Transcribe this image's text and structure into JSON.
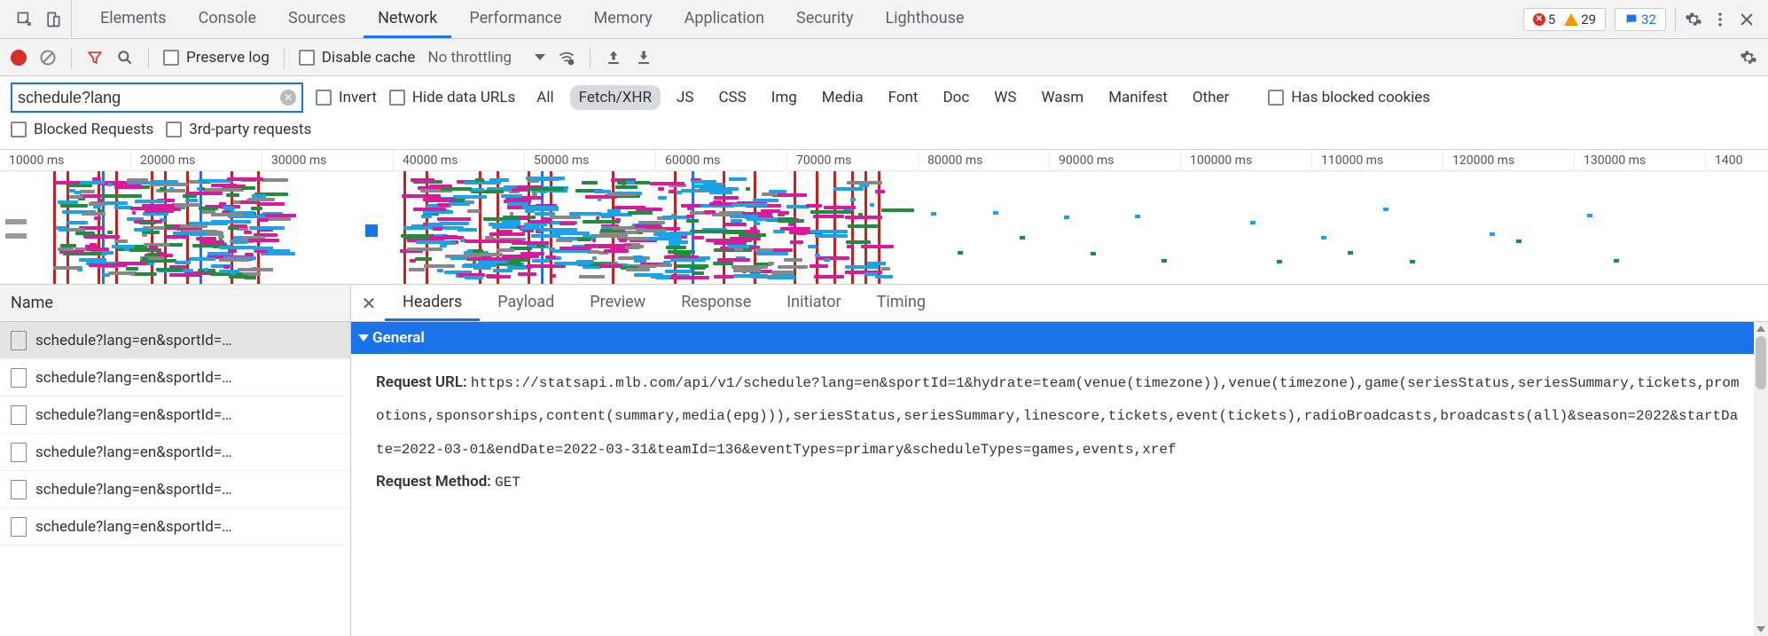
{
  "mainTabs": [
    "Elements",
    "Console",
    "Sources",
    "Network",
    "Performance",
    "Memory",
    "Application",
    "Security",
    "Lighthouse"
  ],
  "activeMainTab": "Network",
  "counts": {
    "errors": "5",
    "warnings": "29",
    "messages": "32"
  },
  "networkToolbar": {
    "preserveLog": "Preserve log",
    "disableCache": "Disable cache",
    "throttling": "No throttling"
  },
  "filter": {
    "value": "schedule?lang",
    "invert": "Invert",
    "hideDataUrls": "Hide data URLs",
    "types": [
      "All",
      "Fetch/XHR",
      "JS",
      "CSS",
      "Img",
      "Media",
      "Font",
      "Doc",
      "WS",
      "Wasm",
      "Manifest",
      "Other"
    ],
    "activeType": "Fetch/XHR",
    "hasBlockedCookies": "Has blocked cookies",
    "blockedRequests": "Blocked Requests",
    "thirdParty": "3rd-party requests"
  },
  "timelineTicks": [
    "10000 ms",
    "20000 ms",
    "30000 ms",
    "40000 ms",
    "50000 ms",
    "60000 ms",
    "70000 ms",
    "80000 ms",
    "90000 ms",
    "100000 ms",
    "110000 ms",
    "120000 ms",
    "130000 ms",
    "1400"
  ],
  "requestList": {
    "header": "Name",
    "items": [
      "schedule?lang=en&sportId=…",
      "schedule?lang=en&sportId=…",
      "schedule?lang=en&sportId=…",
      "schedule?lang=en&sportId=…",
      "schedule?lang=en&sportId=…",
      "schedule?lang=en&sportId=…"
    ],
    "selectedIndex": 0
  },
  "detailsTabs": [
    "Headers",
    "Payload",
    "Preview",
    "Response",
    "Initiator",
    "Timing"
  ],
  "activeDetailsTab": "Headers",
  "general": {
    "section": "General",
    "requestUrlLabel": "Request URL:",
    "requestUrl": "https://statsapi.mlb.com/api/v1/schedule?lang=en&sportId=1&hydrate=team(venue(timezone)),venue(timezone),game(seriesStatus,seriesSummary,tickets,promotions,sponsorships,content(summary,media(epg))),seriesStatus,seriesSummary,linescore,tickets,event(tickets),radioBroadcasts,broadcasts(all)&season=2022&startDate=2022-03-01&endDate=2022-03-31&teamId=136&eventTypes=primary&scheduleTypes=games,events,xref",
    "requestMethodLabel": "Request Method:",
    "requestMethod": "GET"
  }
}
